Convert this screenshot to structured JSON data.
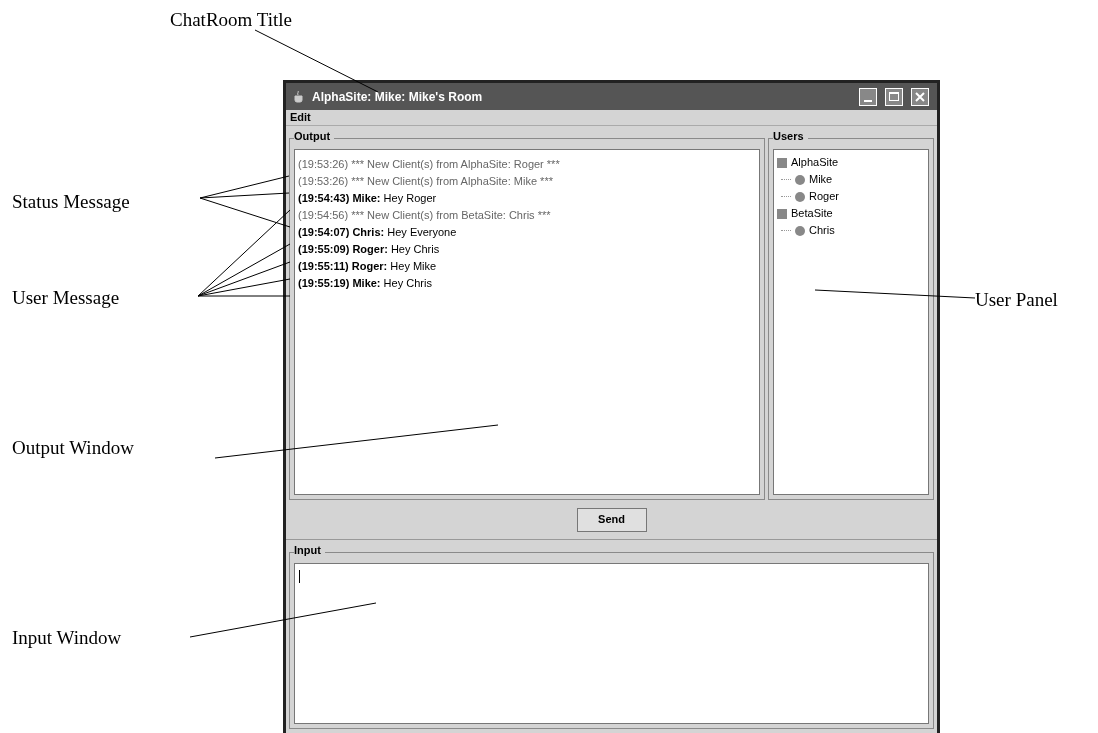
{
  "annotations": [
    {
      "label": "ChatRoom Title"
    },
    {
      "label": "Status Message"
    },
    {
      "label": "User Message"
    },
    {
      "label": "Output Window"
    },
    {
      "label": "Input Window"
    },
    {
      "label": "User Panel"
    }
  ],
  "window": {
    "title": "AlphaSite: Mike: Mike's Room"
  },
  "menu": [
    "Edit"
  ],
  "output": {
    "title": "Output",
    "messages": [
      {
        "kind": "status",
        "text": "(19:53:26) *** New Client(s) from AlphaSite: Roger ***"
      },
      {
        "kind": "status",
        "text": "(19:53:26) *** New Client(s) from AlphaSite: Mike ***"
      },
      {
        "kind": "user",
        "stamp": "(19:54:43) Mike:",
        "text": "Hey Roger"
      },
      {
        "kind": "status",
        "text": "(19:54:56) *** New Client(s) from BetaSite: Chris ***"
      },
      {
        "kind": "user",
        "stamp": "(19:54:07) Chris:",
        "text": "Hey Everyone"
      },
      {
        "kind": "user",
        "stamp": "(19:55:09) Roger:",
        "text": "Hey Chris"
      },
      {
        "kind": "user",
        "stamp": "(19:55:11) Roger:",
        "text": "Hey Mike"
      },
      {
        "kind": "user",
        "stamp": "(19:55:19) Mike:",
        "text": "Hey Chris"
      }
    ]
  },
  "users": {
    "title": "Users",
    "tree": [
      {
        "label": "AlphaSite",
        "children": [
          {
            "label": "Mike"
          },
          {
            "label": "Roger"
          }
        ]
      },
      {
        "label": "BetaSite",
        "children": [
          {
            "label": "Chris"
          }
        ]
      }
    ]
  },
  "send_button": "Send",
  "input": {
    "title": "Input"
  }
}
